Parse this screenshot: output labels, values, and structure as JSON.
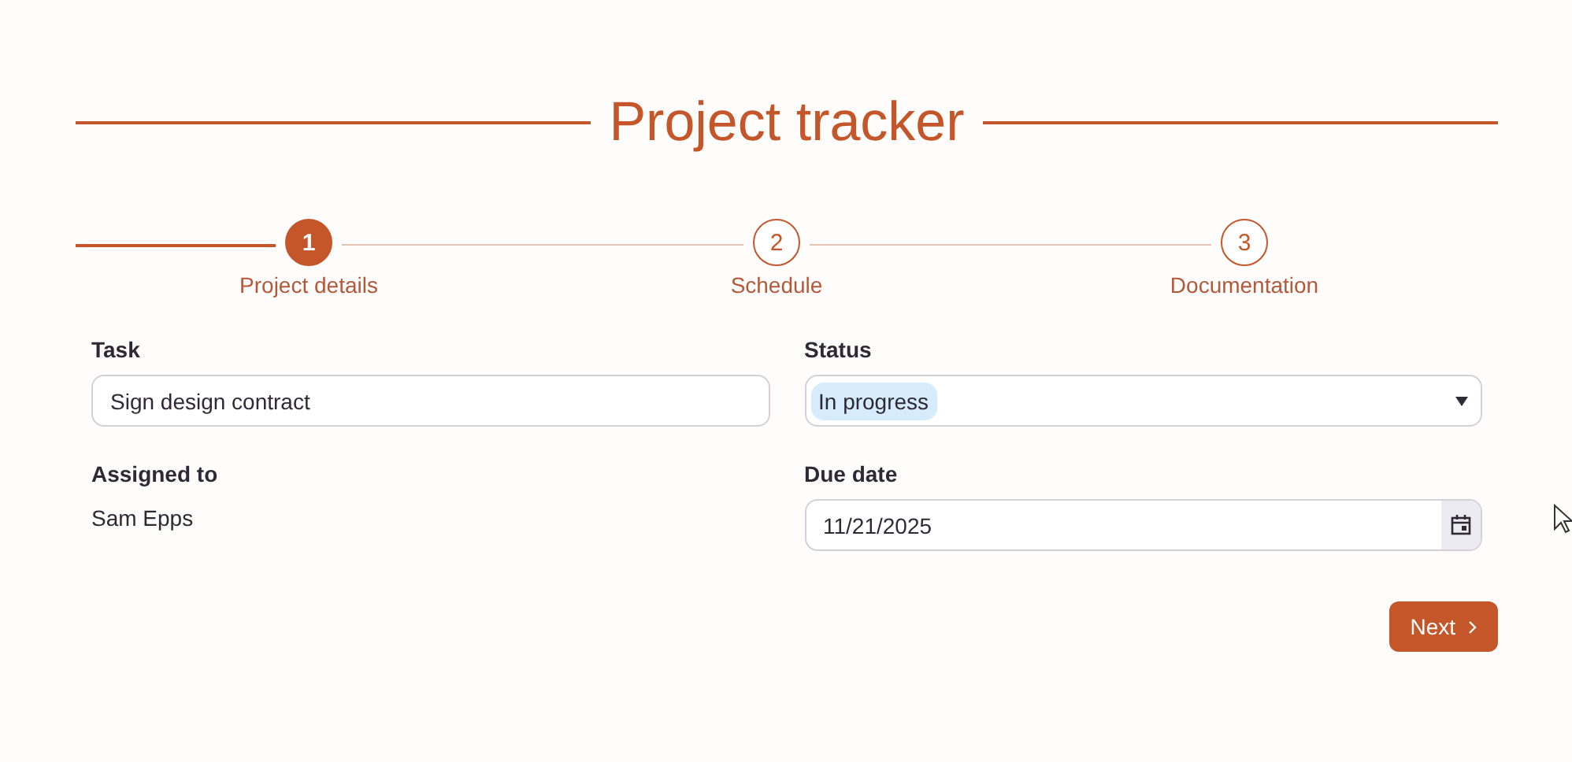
{
  "title": "Project tracker",
  "steps": [
    {
      "number": "1",
      "label": "Project details",
      "selected": true
    },
    {
      "number": "2",
      "label": "Schedule",
      "selected": false
    },
    {
      "number": "3",
      "label": "Documentation",
      "selected": false
    }
  ],
  "fields": [
    {
      "kind": "text",
      "label": "Task",
      "value": "Sign design contract"
    },
    {
      "kind": "select",
      "label": "Status",
      "value": "In progress"
    },
    {
      "kind": "static",
      "label": "Assigned to",
      "value": "Sam Epps"
    },
    {
      "kind": "date",
      "label": "Due date",
      "value": "11/21/2025"
    }
  ],
  "next_button": {
    "label": "Next"
  }
}
